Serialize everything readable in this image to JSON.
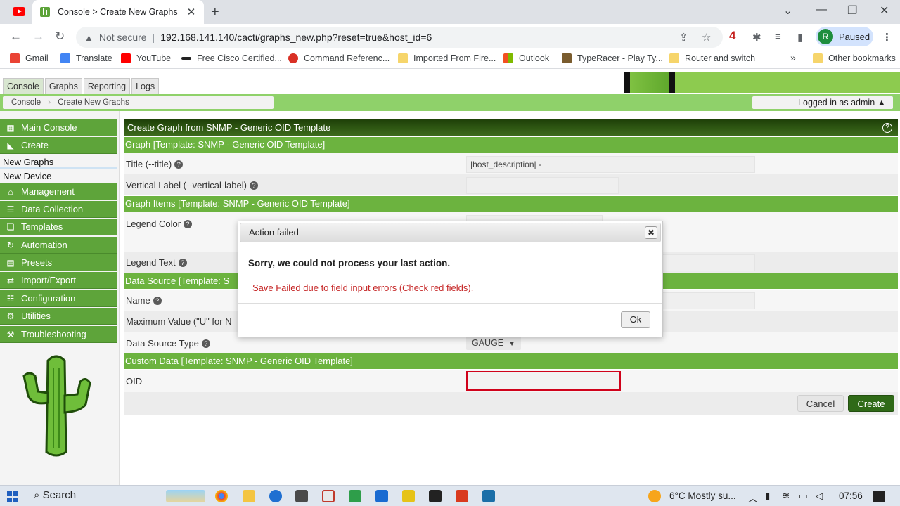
{
  "browser": {
    "tab_title": "Console > Create New Graphs",
    "omnibox_security": "Not secure",
    "url": "192.168.141.140/cacti/graphs_new.php?reset=true&host_id=6",
    "ext_count": "4",
    "profile_initial": "R",
    "profile_status": "Paused",
    "bookmarks": [
      {
        "label": "Gmail"
      },
      {
        "label": "Translate"
      },
      {
        "label": "YouTube"
      },
      {
        "label": "Free Cisco Certified..."
      },
      {
        "label": "Command Referenc..."
      },
      {
        "label": "Imported From Fire..."
      },
      {
        "label": "Outlook"
      },
      {
        "label": "TypeRacer - Play Ty..."
      },
      {
        "label": "Router and switch"
      },
      {
        "label": "Other bookmarks"
      }
    ],
    "overflow": "»"
  },
  "app": {
    "tabs": [
      "Console",
      "Graphs",
      "Reporting",
      "Logs"
    ],
    "breadcrumb": [
      "Console",
      "Create New Graphs"
    ],
    "logged_in": "Logged in as admin ▲",
    "menu": {
      "main_console": "Main Console",
      "create": "Create",
      "new_graphs": "New Graphs",
      "new_device": "New Device",
      "management": "Management",
      "data_collection": "Data Collection",
      "templates": "Templates",
      "automation": "Automation",
      "presets": "Presets",
      "import_export": "Import/Export",
      "configuration": "Configuration",
      "utilities": "Utilities",
      "troubleshooting": "Troubleshooting"
    }
  },
  "form": {
    "panel_title": "Create Graph from SNMP - Generic OID Template",
    "section_graph": "Graph [Template: SNMP - Generic OID Template]",
    "title_label": "Title (--title)",
    "title_value": "|host_description| -",
    "vlabel_label": "Vertical Label (--vertical-label)",
    "section_items": "Graph Items [Template: SNMP - Generic OID Template]",
    "legend_color_label": "Legend Color",
    "legend_text_label": "Legend Text",
    "section_ds": "Data Source [Template: S",
    "name_label": "Name",
    "max_label": "Maximum Value (\"U\" for N",
    "ds_type_label": "Data Source Type",
    "ds_type_value": "GAUGE",
    "section_custom": "Custom Data [Template: SNMP - Generic OID Template]",
    "oid_label": "OID",
    "cancel": "Cancel",
    "create": "Create"
  },
  "dialog": {
    "title": "Action failed",
    "message": "Sorry, we could not process your last action.",
    "error": "Save Failed due to field input errors (Check red fields).",
    "ok": "Ok"
  },
  "taskbar": {
    "search": "Search",
    "weather": "6°C  Mostly su...",
    "time": "07:56"
  },
  "colors": {
    "cacti_green": "#6cb33f",
    "panel_dark": "#2f5d12",
    "error_red": "#d0021b"
  }
}
